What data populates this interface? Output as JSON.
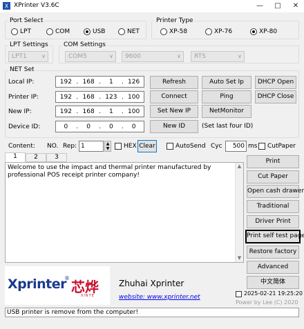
{
  "window": {
    "title": "XPrinter V3.6C"
  },
  "port_select": {
    "legend": "Port Select",
    "options": [
      "LPT",
      "COM",
      "USB",
      "NET"
    ],
    "selected": "USB"
  },
  "printer_type": {
    "legend": "Printer Type",
    "options": [
      "XP-58",
      "XP-76",
      "XP-80"
    ],
    "selected": "XP-80"
  },
  "lpt_settings": {
    "legend": "LPT Settings",
    "value": "LPT1"
  },
  "com_settings": {
    "legend": "COM Settings",
    "port": "COM5",
    "baud": "9600",
    "flow": "RTS"
  },
  "net_set": {
    "legend": "NET Set",
    "local_ip": {
      "label": "Local IP:",
      "octets": [
        "192",
        "168",
        "1",
        "126"
      ]
    },
    "printer_ip": {
      "label": "Printer IP:",
      "octets": [
        "192",
        "168",
        "123",
        "100"
      ]
    },
    "new_ip": {
      "label": "New IP:",
      "octets": [
        "192",
        "168",
        "1",
        "100"
      ]
    },
    "device_id": {
      "label": "Device ID:",
      "octets": [
        "0",
        "0",
        "0",
        "0"
      ]
    },
    "buttons": {
      "refresh": "Refresh",
      "auto_set_ip": "Auto Set Ip",
      "dhcp_open": "DHCP Open",
      "connect": "Connect",
      "ping": "Ping",
      "dhcp_close": "DHCP Close",
      "set_new_ip": "Set New IP",
      "netmonitor": "NetMonitor",
      "new_id": "New ID"
    },
    "new_id_hint": "(Set last four ID)"
  },
  "send_row": {
    "content_label": "Content:",
    "no_label": "NO.",
    "rep_label": "Rep:",
    "rep_value": "1",
    "hex_label": "HEX",
    "clear_label": "Clear",
    "autosend_label": "AutoSend",
    "cyc_label": "Cyc",
    "cyc_value": "500",
    "ms_label": "ms",
    "cutpaper_label": "CutPaper"
  },
  "tabs": [
    "1",
    "2",
    "3"
  ],
  "content_text": "Welcome to use the impact and thermal printer manufactured by professional POS receipt printer company!",
  "side_buttons": {
    "print": "Print",
    "cut_paper": "Cut Paper",
    "open_cash_drawer": "Open cash drawer",
    "traditional": "Traditional",
    "driver_print": "Driver Print",
    "print_self_test": "Print self test page",
    "restore_factory": "Restore factory",
    "advanced": "Advanced",
    "chinese": "中文简体"
  },
  "logo": {
    "brand": "Xprinter",
    "reg": "®",
    "cn": "芯烨",
    "sub": "XINYE"
  },
  "company": {
    "name": "Zhuhai Xprinter",
    "website": "website: www.xprinter.net"
  },
  "datetime": "2025-02-21 19:25:20",
  "powered_by": "Power by Lee (C) 2020",
  "status_text": "USB printer is remove from the computer!",
  "colors": {
    "link": "#0000ee",
    "brand_blue": "#1a3a8f",
    "brand_red": "#c8102e",
    "focus_border": "#0078d7"
  }
}
